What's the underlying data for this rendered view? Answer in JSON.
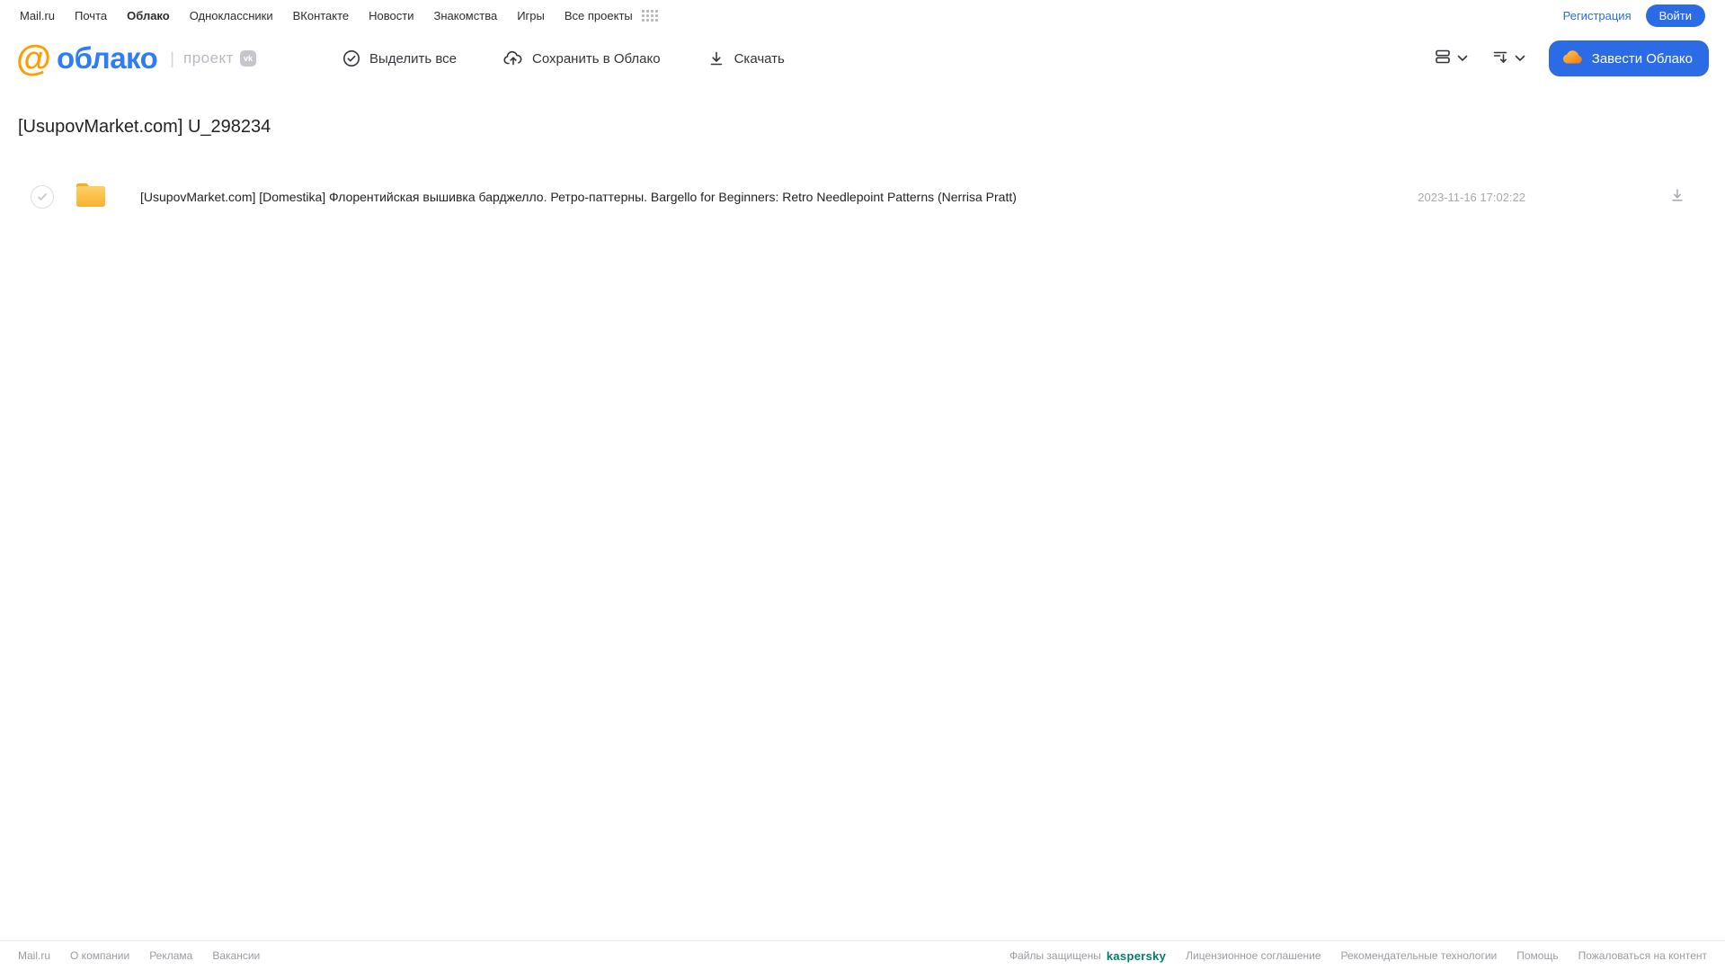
{
  "topnav": {
    "items": [
      {
        "label": "Mail.ru"
      },
      {
        "label": "Почта"
      },
      {
        "label": "Облако"
      },
      {
        "label": "Одноклассники"
      },
      {
        "label": "ВКонтакте"
      },
      {
        "label": "Новости"
      },
      {
        "label": "Знакомства"
      },
      {
        "label": "Игры"
      },
      {
        "label": "Все проекты"
      }
    ],
    "active_item": "Облако",
    "register_label": "Регистрация",
    "login_label": "Войти"
  },
  "header": {
    "logo_at": "@",
    "logo_text": "облако",
    "project_label": "проект",
    "vk_badge": "vk",
    "toolbar": {
      "select_all": "Выделить все",
      "save_to_cloud": "Сохранить в Облако",
      "download": "Скачать"
    },
    "get_cloud_label": "Завести Облако"
  },
  "page": {
    "title": "[UsupovMarket.com] U_298234"
  },
  "files": [
    {
      "name": "[UsupovMarket.com] [Domestika] Флорентийская вышивка барджелло. Ретро-паттерны. Bargello for Beginners: Retro Needlepoint Patterns (Nerrisa Pratt)",
      "date": "2023-11-16 17:02:22",
      "type": "folder"
    }
  ],
  "footer": {
    "left_links": [
      "Mail.ru",
      "О компании",
      "Реклама",
      "Вакансии"
    ],
    "protected_text": "Файлы защищены",
    "kaspersky_label": "kaspersky",
    "right_links": [
      "Лицензионное соглашение",
      "Рекомендательные технологии",
      "Помощь",
      "Пожаловаться на контент"
    ]
  },
  "colors": {
    "accent_blue": "#2b6be5",
    "logo_blue": "#2e7cf6",
    "logo_orange": "#ff9e00",
    "folder_yellow": "#fcc44d",
    "kaspersky_teal": "#007c6c",
    "muted_gray": "#9a9ca2"
  }
}
